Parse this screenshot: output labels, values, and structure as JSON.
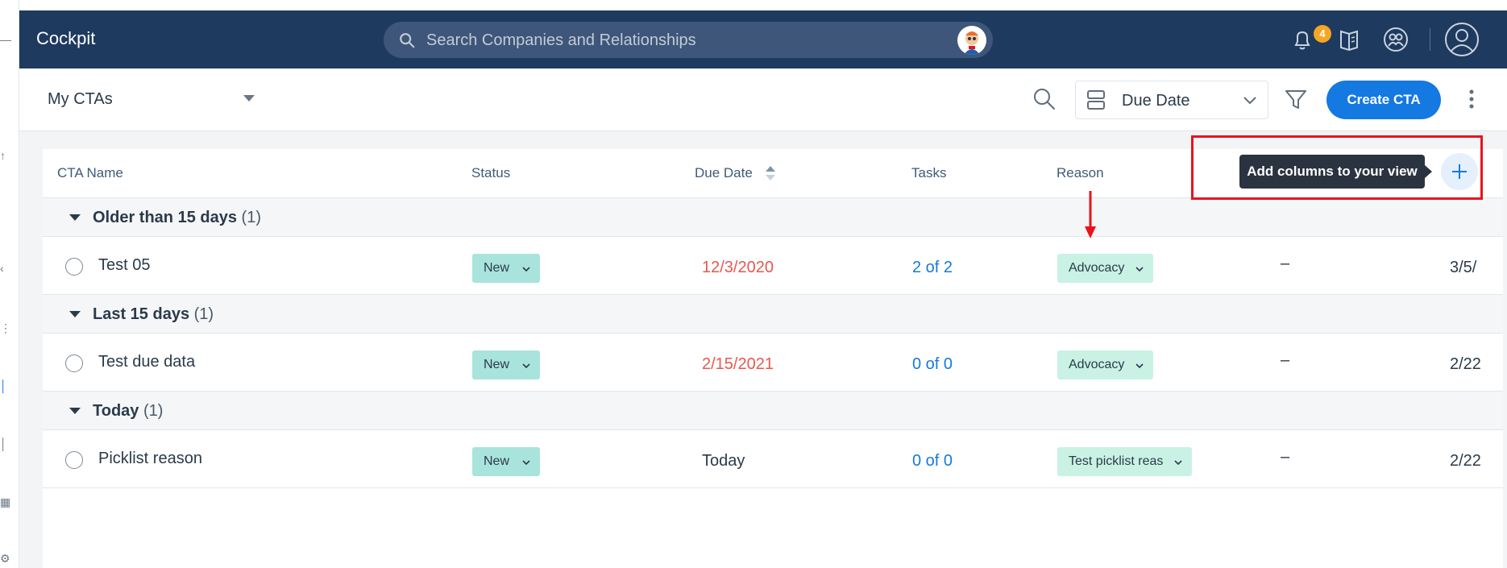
{
  "app": {
    "title": "Cockpit"
  },
  "search": {
    "placeholder": "Search Companies and Relationships"
  },
  "notifications": {
    "count": "4"
  },
  "icons": {
    "bell": "bell-icon",
    "book": "book-icon",
    "people": "people-icon",
    "user": "user-avatar-icon",
    "search": "search-icon",
    "filter": "filter-icon",
    "layout": "layout-rows-icon",
    "kebab": "more-vertical-icon",
    "add": "plus-icon"
  },
  "subbar": {
    "view_label": "My CTAs",
    "sort_label": "Due Date",
    "create_button": "Create CTA"
  },
  "columns": {
    "name": "CTA Name",
    "status": "Status",
    "due_date": "Due Date",
    "tasks": "Tasks",
    "reason": "Reason"
  },
  "tooltip": {
    "text": "Add columns to your view"
  },
  "groups": [
    {
      "label": "Older than 15 days",
      "count": "(1)",
      "rows": [
        {
          "name": "Test 05",
          "status": "New",
          "due": "12/3/2020",
          "tasks": "2 of 2",
          "reason": "Advocacy",
          "owner": "–",
          "extra": "3/5/"
        }
      ]
    },
    {
      "label": "Last 15 days",
      "count": "(1)",
      "rows": [
        {
          "name": "Test due data",
          "status": "New",
          "due": "2/15/2021",
          "tasks": "0 of 0",
          "reason": "Advocacy",
          "owner": "–",
          "extra": "2/22"
        }
      ]
    },
    {
      "label": "Today",
      "count": "(1)",
      "rows": [
        {
          "name": "Picklist reason",
          "status": "New",
          "due": "Today",
          "tasks": "0 of 0",
          "reason": "Test picklist reas",
          "owner": "–",
          "extra": "2/22"
        }
      ]
    }
  ],
  "colors": {
    "topbar": "#1e3a5f",
    "primary": "#1479e0",
    "overdue": "#e8574f",
    "status_bg": "#a8e4dc",
    "reason_bg": "#c9f2e4",
    "highlight": "#e8141c"
  }
}
